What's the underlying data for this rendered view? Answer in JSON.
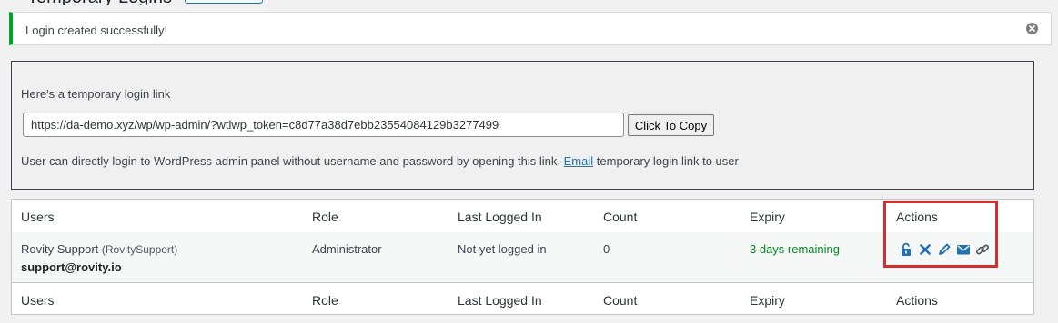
{
  "notice": {
    "message": "Login created successfully!"
  },
  "link_box": {
    "intro": "Here's a temporary login link",
    "url": "https://da-demo.xyz/wp/wp-admin/?wtlwp_token=c8d77a38d7ebb23554084129b3277499",
    "copy_label": "Click To Copy",
    "desc_before": "User can directly login to WordPress admin panel without username and password by opening this link.",
    "desc_link": "Email",
    "desc_after": "temporary login link to user"
  },
  "table": {
    "columns": [
      "Users",
      "Role",
      "Last Logged In",
      "Count",
      "Expiry",
      "Actions"
    ],
    "rows": [
      {
        "name": "Rovity Support",
        "login": "(RovitySupport)",
        "email": "support@rovity.io",
        "role": "Administrator",
        "last_logged_in": "Not yet logged in",
        "count": "0",
        "expiry": "3 days remaining"
      }
    ],
    "action_icons": [
      "lock-icon",
      "close-icon",
      "pencil-icon",
      "email-icon",
      "link-icon"
    ]
  },
  "colors": {
    "notice_accent": "#00a32a",
    "link": "#2271b1",
    "expiry_ok": "#008a20",
    "highlight": "#d32f2f"
  }
}
